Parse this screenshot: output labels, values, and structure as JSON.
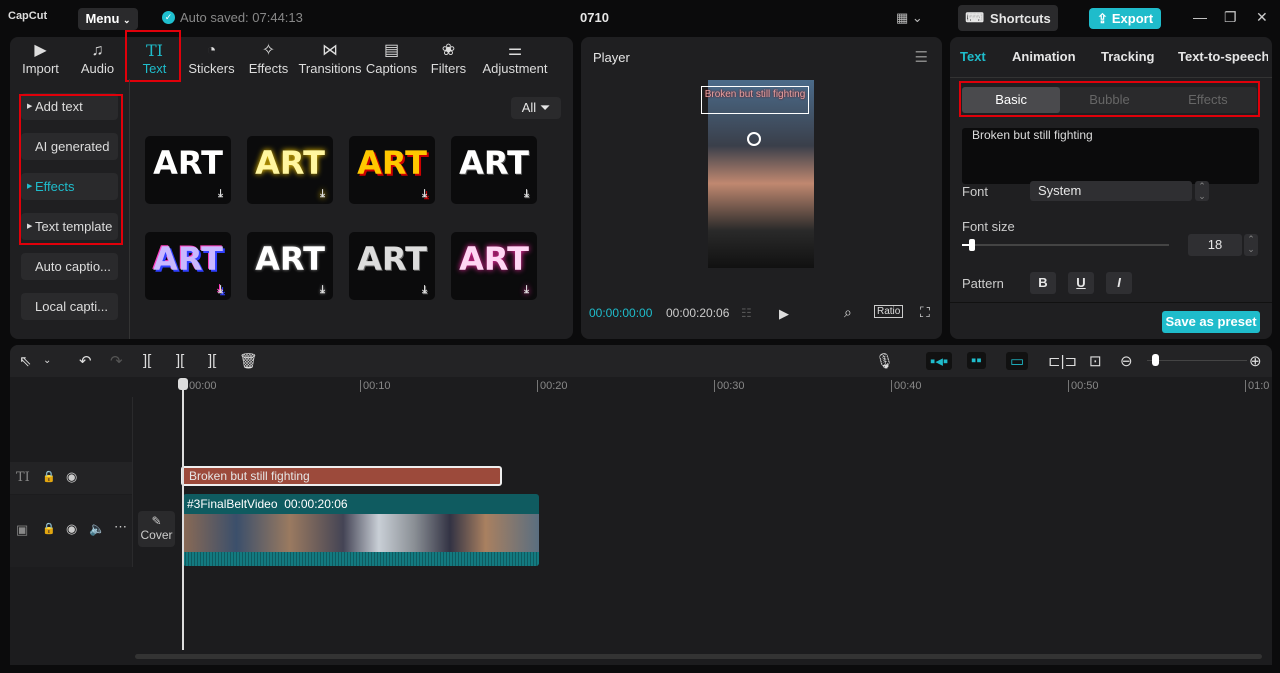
{
  "app": {
    "logo": "CapCut",
    "menu_label": "Menu",
    "autosave": "Auto saved: 07:44:13",
    "project_name": "0710",
    "shortcuts_label": "Shortcuts",
    "export_label": "Export"
  },
  "media_tabs": [
    {
      "label": "Import",
      "icon": "▶"
    },
    {
      "label": "Audio",
      "icon": "♫"
    },
    {
      "label": "Text",
      "icon": "TI"
    },
    {
      "label": "Stickers",
      "icon": "◔"
    },
    {
      "label": "Effects",
      "icon": "✧"
    },
    {
      "label": "Transitions",
      "icon": "⋈"
    },
    {
      "label": "Captions",
      "icon": "▤"
    },
    {
      "label": "Filters",
      "icon": "❀"
    },
    {
      "label": "Adjustment",
      "icon": "⚌"
    }
  ],
  "text_sidebar": [
    {
      "label": "Add text"
    },
    {
      "label": "AI generated"
    },
    {
      "label": "Effects"
    },
    {
      "label": "Text template"
    },
    {
      "label": "Auto captio..."
    },
    {
      "label": "Local capti..."
    }
  ],
  "filter_label": "All",
  "art_presets": [
    {
      "label": "ART"
    },
    {
      "label": "ART"
    },
    {
      "label": "ART"
    },
    {
      "label": "ART"
    },
    {
      "label": "ART"
    },
    {
      "label": "ART"
    },
    {
      "label": "ART"
    },
    {
      "label": "ART"
    }
  ],
  "player": {
    "title": "Player",
    "caption": "Broken but still fighting",
    "current_time": "00:00:00:00",
    "duration": "00:00:20:06",
    "ratio_label": "Ratio"
  },
  "inspector": {
    "tabs": [
      "Text",
      "Animation",
      "Tracking",
      "Text-to-speech"
    ],
    "subtabs": [
      "Basic",
      "Bubble",
      "Effects"
    ],
    "text_value": "Broken but still fighting",
    "font_label": "Font",
    "font_value": "System",
    "font_size_label": "Font size",
    "font_size": "18",
    "font_size_fraction": 0.05,
    "pattern_label": "Pattern",
    "pattern_buttons": [
      "B",
      "U",
      "I"
    ],
    "save_preset": "Save as preset"
  },
  "timeline": {
    "ruler": [
      "00:00",
      "00:10",
      "00:20",
      "00:30",
      "00:40",
      "00:50",
      "01:0"
    ],
    "text_clip": "Broken but still fighting",
    "video_clip_name": "#3FinalBeltVideo",
    "video_clip_duration": "00:00:20:06",
    "cover_label": "Cover",
    "zoom_fraction": 0.05
  },
  "colors": {
    "accent": "#1fbccb",
    "text_clip": "#9c4a3b",
    "video_clip": "#0f5b60"
  }
}
